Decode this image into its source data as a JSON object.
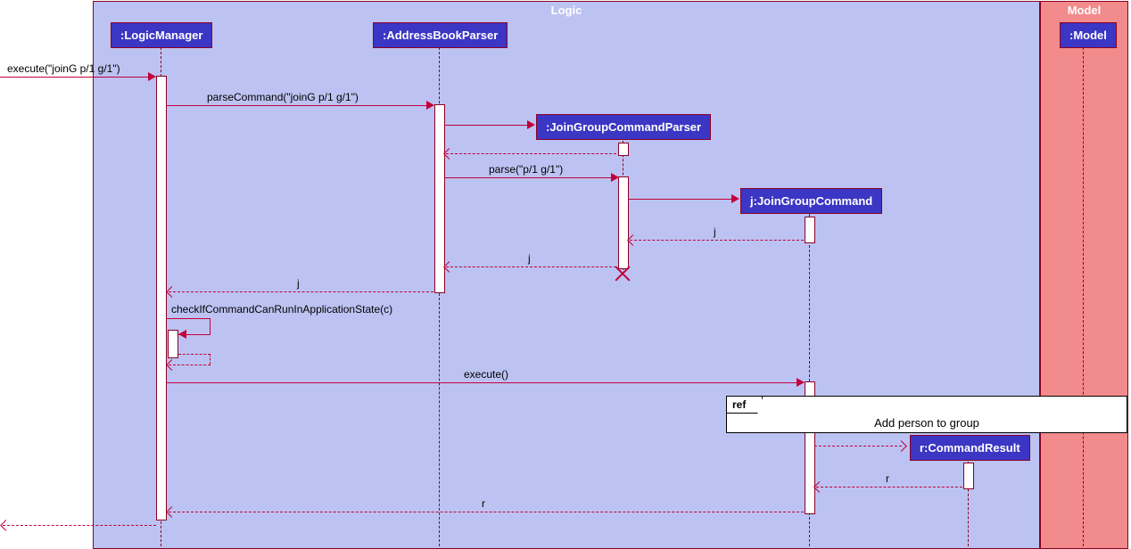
{
  "frames": {
    "logic": {
      "label": "Logic"
    },
    "model": {
      "label": "Model"
    }
  },
  "participants": {
    "logicManager": ":LogicManager",
    "addressBookParser": ":AddressBookParser",
    "joinGroupCommandParser": ":JoinGroupCommandParser",
    "joinGroupCommand": "j:JoinGroupCommand",
    "modelHead": ":Model",
    "commandResult": "r:CommandResult"
  },
  "messages": {
    "execute1": "execute(\"joinG p/1 g/1\")",
    "parseCommand": "parseCommand(\"joinG p/1 g/1\")",
    "parse": "parse(\"p/1 g/1\")",
    "j1": "j",
    "j2": "j",
    "j3": "j",
    "checkIf": "checkIfCommandCanRunInApplicationState(c)",
    "execute2": "execute()",
    "r1": "r",
    "r2": "r"
  },
  "ref": {
    "tab": "ref",
    "text": "Add person to group"
  }
}
